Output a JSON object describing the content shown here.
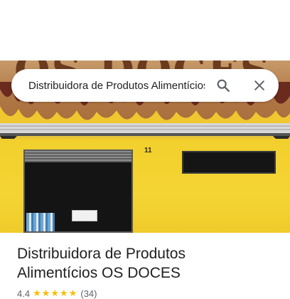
{
  "search": {
    "query": "Distribuidora de Produtos Alimentícios OS DOCES",
    "search_label": "Search",
    "close_label": "Close"
  },
  "photo": {
    "sign_text": "OS DOCES",
    "house_number": "11"
  },
  "place": {
    "title_line1": "Distribuidora de Produtos",
    "title_line2": "Alimentícios OS DOCES",
    "rating": "4.4",
    "stars": "★★★★★",
    "review_count": "(34)"
  },
  "colors": {
    "star": "#fbbc04",
    "wall_yellow": "#f2cf2c",
    "text": "#202124"
  }
}
